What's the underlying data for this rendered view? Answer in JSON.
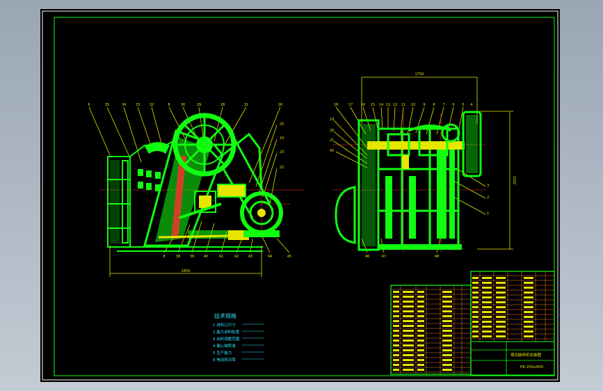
{
  "drawing": {
    "front_view": {
      "width_dimension": "1850",
      "top_callouts": [
        "6",
        "35",
        "34",
        "33",
        "32",
        "8",
        "30",
        "29",
        "28",
        "31",
        "26"
      ],
      "right_callouts": [
        "25",
        "24",
        "23",
        "22"
      ],
      "bottom_callouts": [
        "8",
        "38",
        "39",
        "40",
        "41",
        "42",
        "43",
        "44",
        "45"
      ]
    },
    "side_view": {
      "width_dimension": "1750",
      "height_dimension": "1562",
      "top_callouts": [
        "18",
        "17",
        "16",
        "15",
        "14",
        "13",
        "12",
        "11",
        "10",
        "9",
        "8",
        "7",
        "6",
        "5",
        "4"
      ],
      "left_callouts": [
        "19",
        "20",
        "21",
        "42"
      ],
      "right_callouts": [
        "3",
        "2",
        "1"
      ],
      "bottom_callouts": [
        "46",
        "47",
        "48"
      ]
    },
    "tech_requirements": {
      "title": "技术规格",
      "items": [
        "1 进料口尺寸",
        "2 最大进料粒度",
        "3 出料调整范围",
        "4 偏心轴转速",
        "5 生产能力",
        "6 电动机功率"
      ]
    },
    "title_block": {
      "title": "颚式破碎机总装图",
      "drawing_no": "PE-250x400"
    }
  }
}
